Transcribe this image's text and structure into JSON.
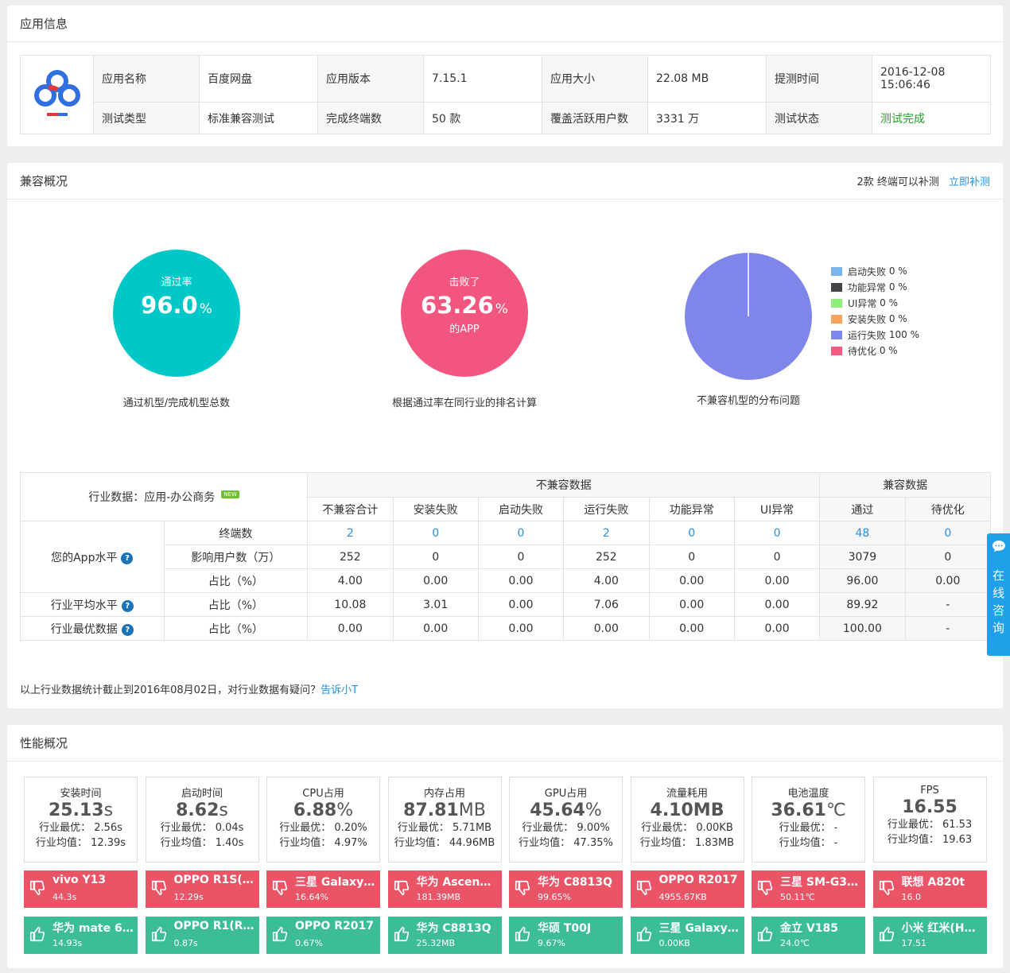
{
  "app_info": {
    "title": "应用信息",
    "row1": [
      {
        "label": "应用名称",
        "value": "百度网盘"
      },
      {
        "label": "应用版本",
        "value": "7.15.1"
      },
      {
        "label": "应用大小",
        "value": "22.08 MB"
      },
      {
        "label": "提测时间",
        "value": "2016-12-08 15:06:46"
      }
    ],
    "row2": [
      {
        "label": "测试类型",
        "value": "标准兼容测试"
      },
      {
        "label": "完成终端数",
        "value": "50 款"
      },
      {
        "label": "覆盖活跃用户数",
        "value": "3331 万"
      },
      {
        "label": "测试状态",
        "value": "测试完成"
      }
    ],
    "time_line1": "2016-12-08",
    "time_line2": "15:06:46"
  },
  "compat": {
    "title": "兼容概况",
    "retest_text": "2款 终端可以补测",
    "retest_link": "立即补测",
    "pass_circle": {
      "label": "通过率",
      "value": "96.0",
      "unit": "%",
      "caption": "通过机型/完成机型总数"
    },
    "beat_circle": {
      "label": "击败了",
      "value": "63.26",
      "unit": "%",
      "sub": "的APP",
      "caption": "根据通过率在同行业的排名计算"
    },
    "pie_caption": "不兼容机型的分布问题",
    "legend": [
      {
        "name": "启动失败",
        "value": "0 %",
        "color": "#7cb5ec"
      },
      {
        "name": "功能异常",
        "value": "0 %",
        "color": "#434348"
      },
      {
        "name": "UI异常",
        "value": "0 %",
        "color": "#90ed7d"
      },
      {
        "name": "安装失败",
        "value": "0 %",
        "color": "#f7a35c"
      },
      {
        "name": "运行失败",
        "value": "100 %",
        "color": "#8085e9"
      },
      {
        "name": "待优化",
        "value": "0 %",
        "color": "#f15c80"
      }
    ],
    "table": {
      "industry_label": "行业数据：应用-办公商务",
      "new_badge": "NEW",
      "group_incompat": "不兼容数据",
      "group_compat": "兼容数据",
      "columns": [
        "不兼容合计",
        "安装失败",
        "启动失败",
        "运行失败",
        "功能异常",
        "UI异常",
        "通过",
        "待优化"
      ],
      "your_level": "您的App水平",
      "industry_avg": "行业平均水平",
      "industry_best": "行业最优数据",
      "rows": [
        {
          "sub": "终端数",
          "values": [
            "2",
            "0",
            "0",
            "2",
            "0",
            "0",
            "48",
            "0"
          ]
        },
        {
          "sub": "影响用户数（万）",
          "values": [
            "252",
            "0",
            "0",
            "252",
            "0",
            "0",
            "3079",
            "0"
          ]
        },
        {
          "sub": "占比（%）",
          "values": [
            "4.00",
            "0.00",
            "0.00",
            "4.00",
            "0.00",
            "0.00",
            "96.00",
            "0.00"
          ]
        },
        {
          "sub": "占比（%）",
          "values": [
            "10.08",
            "3.01",
            "0.00",
            "7.06",
            "0.00",
            "0.00",
            "89.92",
            "-"
          ]
        },
        {
          "sub": "占比（%）",
          "values": [
            "0.00",
            "0.00",
            "0.00",
            "0.00",
            "0.00",
            "0.00",
            "100.00",
            "-"
          ]
        }
      ]
    },
    "note_text": "以上行业数据统计截止到2016年08月02日，对行业数据有疑问？",
    "note_link": "告诉小T"
  },
  "side_tab": {
    "chars": [
      "在",
      "线",
      "咨",
      "询"
    ]
  },
  "perf": {
    "title": "性能概况",
    "metrics": [
      {
        "name": "安装时间",
        "value": "25.13",
        "unit": "s",
        "best": "行业最优： 2.56s",
        "avg": "行业均值： 12.39s",
        "worst": {
          "name": "vivo Y13",
          "val": "44.3s"
        },
        "best_dev": {
          "name": "华为 mate 6(…",
          "val": "14.93s"
        }
      },
      {
        "name": "启动时间",
        "value": "8.62",
        "unit": "s",
        "best": "行业最优： 0.04s",
        "avg": "行业均值： 1.40s",
        "worst": {
          "name": "OPPO R1S(R…",
          "val": "12.29s"
        },
        "best_dev": {
          "name": "OPPO R1(R8…",
          "val": "0.87s"
        }
      },
      {
        "name": "CPU占用",
        "value": "6.88",
        "unit": "%",
        "best": "行业最优： 0.20%",
        "avg": "行业均值： 4.97%",
        "worst": {
          "name": "三星 Galaxy T…",
          "val": "16.64%"
        },
        "best_dev": {
          "name": "OPPO R2017",
          "val": "0.67%"
        }
      },
      {
        "name": "内存占用",
        "value": "87.81",
        "unit": "MB",
        "best": "行业最优： 5.71MB",
        "avg": "行业均值： 44.96MB",
        "worst": {
          "name": "华为 Ascend …",
          "val": "181.39MB"
        },
        "best_dev": {
          "name": "华为 C8813Q",
          "val": "25.32MB"
        }
      },
      {
        "name": "GPU占用",
        "value": "45.64",
        "unit": "%",
        "best": "行业最优： 9.00%",
        "avg": "行业均值： 47.35%",
        "worst": {
          "name": "华为 C8813Q",
          "val": "99.65%"
        },
        "best_dev": {
          "name": "华硕 T00J",
          "val": "9.67%"
        }
      },
      {
        "name": "流量耗用",
        "value": "4.10MB",
        "unit": "",
        "best": "行业最优： 0.00KB",
        "avg": "行业均值： 1.83MB",
        "worst": {
          "name": "OPPO R2017",
          "val": "4955.67KB"
        },
        "best_dev": {
          "name": "三星 Galaxy S…",
          "val": "0.00KB"
        }
      },
      {
        "name": "电池温度",
        "value": "36.61",
        "unit": "℃",
        "best": "行业最优： -",
        "avg": "行业均值： -",
        "worst": {
          "name": "三星 SM-G35…",
          "val": "50.11℃"
        },
        "best_dev": {
          "name": "金立 V185",
          "val": "24.0℃"
        }
      },
      {
        "name": "FPS",
        "value": "16.55",
        "unit": "",
        "best": "行业最优： 61.53",
        "avg": "行业均值： 19.63",
        "worst": {
          "name": "联想 A820t",
          "val": "16.0"
        },
        "best_dev": {
          "name": "小米 红米(HM…",
          "val": "17.51"
        }
      }
    ]
  }
}
